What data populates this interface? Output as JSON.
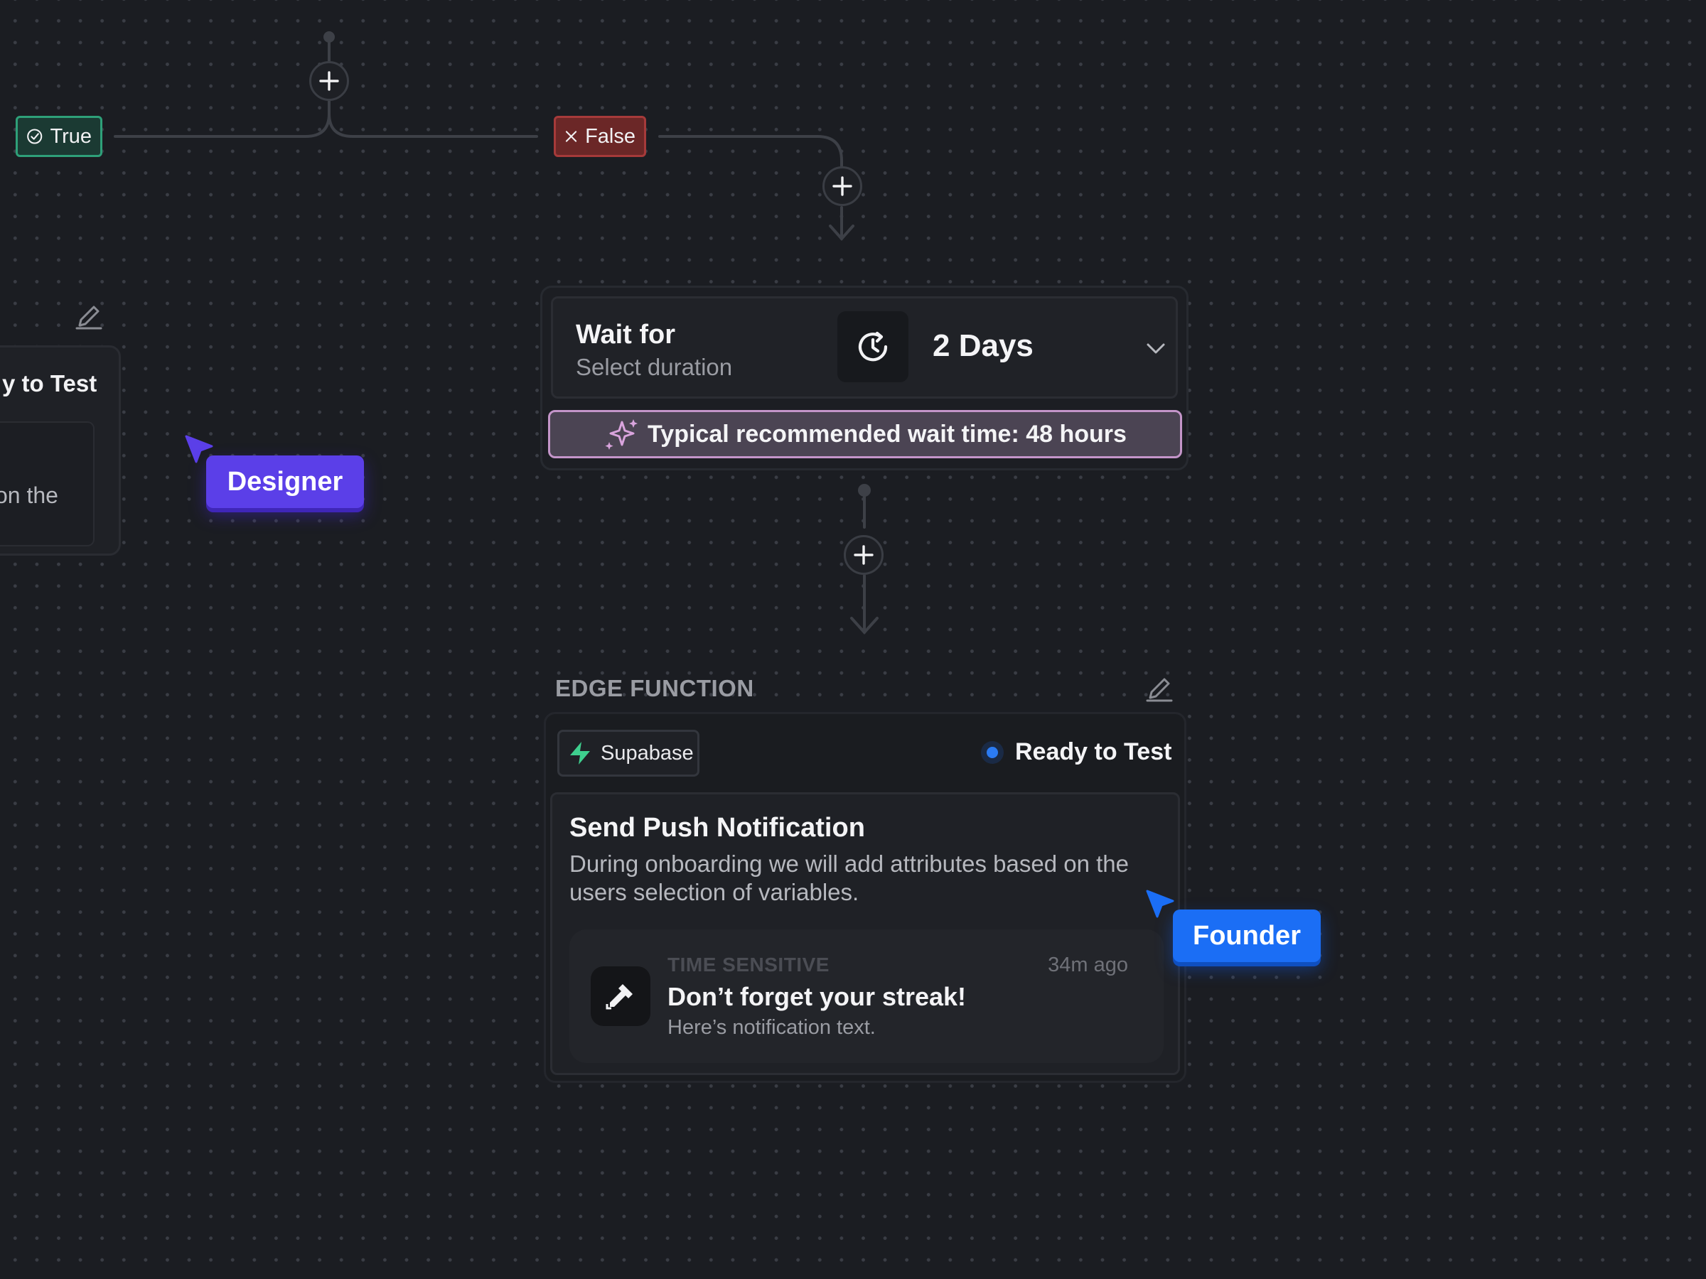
{
  "branches": {
    "true_label": "True",
    "false_label": "False"
  },
  "left_card": {
    "title": "y to Test",
    "text": "on the"
  },
  "wait": {
    "title": "Wait for",
    "subtitle": "Select duration",
    "duration": "2 Days",
    "hint": "Typical recommended wait time: 48 hours"
  },
  "edge_function": {
    "section_label": "EDGE FUNCTION",
    "provider": "Supabase",
    "status": "Ready to Test",
    "title": "Send Push Notification",
    "description": "During onboarding we will add attributes based on the users selection of variables.",
    "notification": {
      "kicker": "TIME SENSITIVE",
      "time": "34m ago",
      "title": "Don’t forget your streak!",
      "text": "Here’s notification text."
    }
  },
  "cursors": {
    "designer": "Designer",
    "founder": "Founder"
  },
  "colors": {
    "canvas": "#1b1d22",
    "true_accent": "#2ea079",
    "false_accent": "#a63a3a",
    "hint_border": "#c495c9",
    "designer": "#5b3fe8",
    "founder": "#1b6ef5",
    "status_dot": "#2b7bf3",
    "supabase": "#3ecf8e"
  },
  "icons": [
    "plus-icon",
    "check-circle-icon",
    "close-icon",
    "pencil-icon",
    "clock-icon",
    "chevron-down-icon",
    "sparkles-icon",
    "supabase-bolt-icon",
    "app-icon",
    "cursor-arrow-icon"
  ]
}
